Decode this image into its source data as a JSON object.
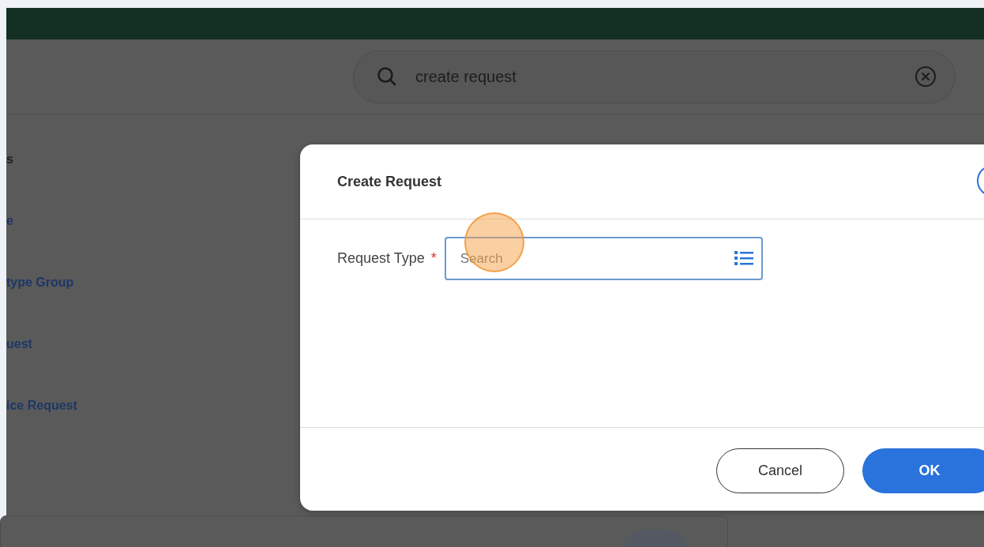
{
  "search": {
    "value": "create request"
  },
  "results": [
    {
      "label": "s"
    },
    {
      "label": "e"
    },
    {
      "label": "type Group"
    },
    {
      "label": "uest"
    },
    {
      "label": "ice Request"
    }
  ],
  "dialog": {
    "title": "Create Request",
    "field": {
      "label": "Request Type",
      "required": true,
      "required_mark": "*",
      "placeholder": "Search"
    },
    "buttons": [
      {
        "label": "Cancel",
        "kind": "secondary"
      },
      {
        "label": "OK",
        "kind": "primary"
      }
    ]
  }
}
